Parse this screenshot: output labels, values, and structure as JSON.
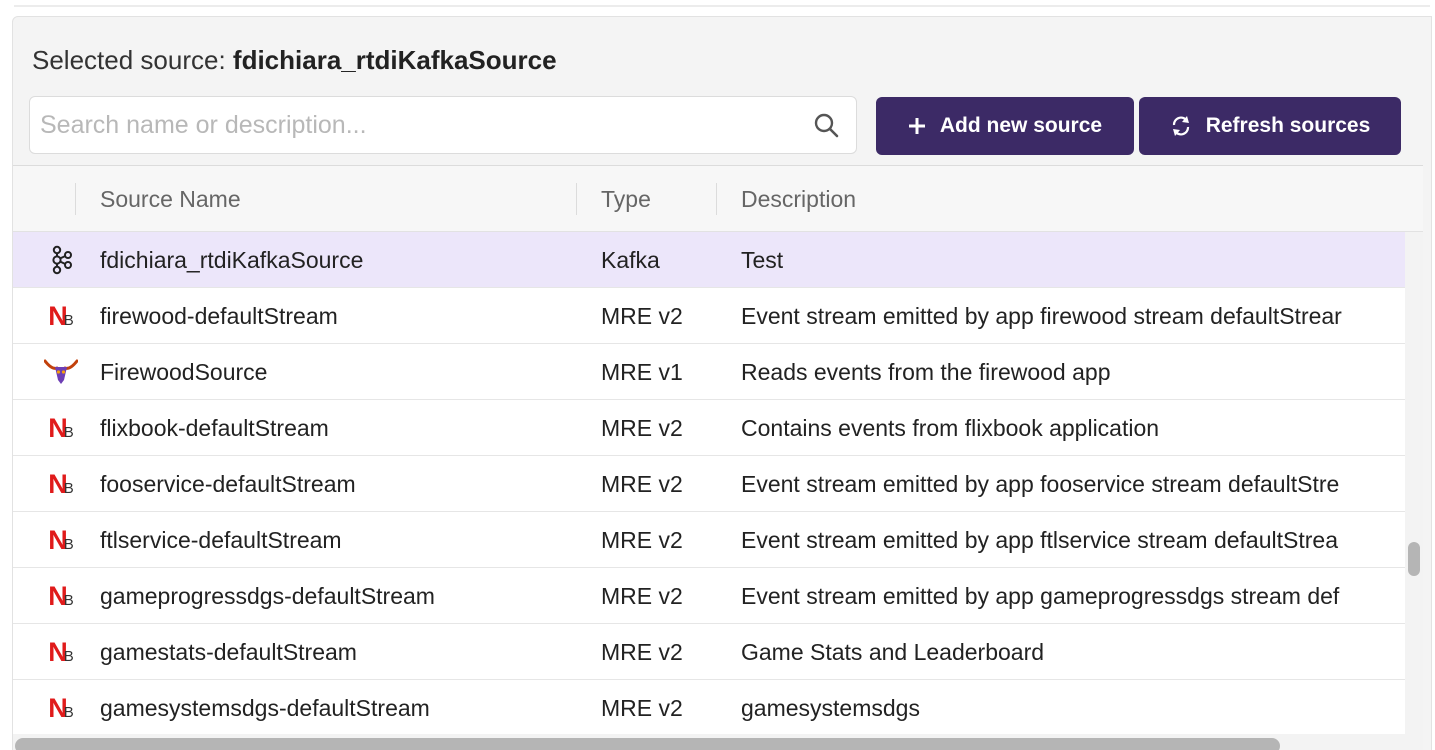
{
  "header": {
    "selected_label": "Selected source:",
    "selected_value": "fdichiara_rtdiKafkaSource"
  },
  "search": {
    "placeholder": "Search name or description...",
    "value": ""
  },
  "toolbar": {
    "add_label": "Add new source",
    "refresh_label": "Refresh sources"
  },
  "table": {
    "columns": {
      "name": "Source Name",
      "type": "Type",
      "description": "Description"
    },
    "rows": [
      {
        "icon": "kafka-icon",
        "name": "fdichiara_rtdiKafkaSource",
        "type": "Kafka",
        "description": "Test"
      },
      {
        "icon": "mre-v2-icon",
        "name": "firewood-defaultStream",
        "type": "MRE v2",
        "description": "Event stream emitted by app firewood stream defaultStrear"
      },
      {
        "icon": "mre-v1-icon",
        "name": "FirewoodSource",
        "type": "MRE v1",
        "description": "Reads events from the firewood app"
      },
      {
        "icon": "mre-v2-icon",
        "name": "flixbook-defaultStream",
        "type": "MRE v2",
        "description": "Contains events from flixbook application"
      },
      {
        "icon": "mre-v2-icon",
        "name": "fooservice-defaultStream",
        "type": "MRE v2",
        "description": "Event stream emitted by app fooservice stream defaultStre"
      },
      {
        "icon": "mre-v2-icon",
        "name": "ftlservice-defaultStream",
        "type": "MRE v2",
        "description": "Event stream emitted by app ftlservice stream defaultStrea"
      },
      {
        "icon": "mre-v2-icon",
        "name": "gameprogressdgs-defaultStream",
        "type": "MRE v2",
        "description": "Event stream emitted by app gameprogressdgs stream def"
      },
      {
        "icon": "mre-v2-icon",
        "name": "gamestats-defaultStream",
        "type": "MRE v2",
        "description": "Game Stats and Leaderboard"
      },
      {
        "icon": "mre-v2-icon",
        "name": "gamesystemsdgs-defaultStream",
        "type": "MRE v2",
        "description": "gamesystemsdgs"
      }
    ]
  },
  "colors": {
    "button_bg": "#3c2a66",
    "selected_row_bg": "#ece6fa",
    "mre_icon_red": "#e01b1b"
  }
}
